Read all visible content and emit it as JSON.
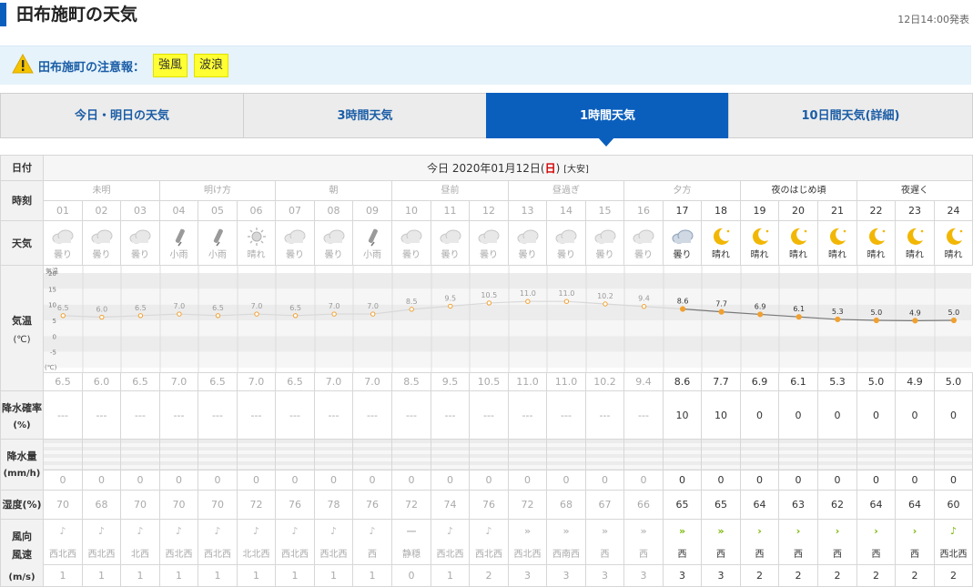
{
  "page": {
    "title": "田布施町の天気",
    "issued": "12日14:00発表"
  },
  "warning": {
    "label": "田布施町の注意報：",
    "items": [
      "強風",
      "波浪"
    ]
  },
  "tabs": [
    {
      "label": "今日・明日の天気",
      "active": false
    },
    {
      "label": "3時間天気",
      "active": false
    },
    {
      "label": "1時間天気",
      "active": true
    },
    {
      "label": "10日間天気(詳細)",
      "active": false
    }
  ],
  "table": {
    "labels": {
      "date": "日付",
      "time": "時刻",
      "weather": "天気",
      "temp": "気温",
      "temp_unit": "(℃)",
      "precip_prob": "降水確率",
      "precip_prob_unit": "(%)",
      "precip_amt": "降水量",
      "precip_amt_unit": "(mm/h)",
      "humidity": "湿度(%)",
      "wind_dir": "風向",
      "wind_speed": "風速",
      "wind_unit": "(m/s)"
    },
    "date": {
      "prefix": "今日 2020年01月12日(",
      "dow": "日",
      "suffix": ")",
      "rokuyo": "[大安]"
    },
    "periods": [
      "未明",
      "明け方",
      "朝",
      "昼前",
      "昼過ぎ",
      "夕方",
      "夜のはじめ頃",
      "夜遅く"
    ],
    "hours": [
      "01",
      "02",
      "03",
      "04",
      "05",
      "06",
      "07",
      "08",
      "09",
      "10",
      "11",
      "12",
      "13",
      "14",
      "15",
      "16",
      "17",
      "18",
      "19",
      "20",
      "21",
      "22",
      "23",
      "24"
    ],
    "weather": [
      "曇り",
      "曇り",
      "曇り",
      "小雨",
      "小雨",
      "晴れ",
      "曇り",
      "曇り",
      "小雨",
      "曇り",
      "曇り",
      "曇り",
      "曇り",
      "曇り",
      "曇り",
      "曇り",
      "曇り",
      "晴れ",
      "晴れ",
      "晴れ",
      "晴れ",
      "晴れ",
      "晴れ",
      "晴れ"
    ],
    "weather_icons": [
      "cloud-icon",
      "cloud-icon",
      "cloud-icon",
      "umbrella-icon",
      "umbrella-icon",
      "sun-icon",
      "cloud-icon",
      "cloud-icon",
      "umbrella-icon",
      "cloud-icon",
      "cloud-icon",
      "cloud-icon",
      "cloud-icon",
      "cloud-icon",
      "cloud-icon",
      "cloud-icon",
      "cloud-icon",
      "moon-icon",
      "moon-icon",
      "moon-icon",
      "moon-icon",
      "moon-icon",
      "moon-icon",
      "moon-icon"
    ],
    "temps_display": [
      "6.5",
      "6.0",
      "6.5",
      "7.0",
      "6.5",
      "7.0",
      "6.5",
      "7.0",
      "7.0",
      "8.5",
      "9.5",
      "10.5",
      "11.0",
      "11.0",
      "10.2",
      "9.4",
      "8.6",
      "7.7",
      "6.9",
      "6.1",
      "5.3",
      "5.0",
      "4.9",
      "5.0"
    ],
    "precip_prob": [
      "---",
      "---",
      "---",
      "---",
      "---",
      "---",
      "---",
      "---",
      "---",
      "---",
      "---",
      "---",
      "---",
      "---",
      "---",
      "---",
      "10",
      "10",
      "0",
      "0",
      "0",
      "0",
      "0",
      "0"
    ],
    "precip_amt": [
      "0",
      "0",
      "0",
      "0",
      "0",
      "0",
      "0",
      "0",
      "0",
      "0",
      "0",
      "0",
      "0",
      "0",
      "0",
      "0",
      "0",
      "0",
      "0",
      "0",
      "0",
      "0",
      "0",
      "0"
    ],
    "humidity": [
      "70",
      "68",
      "70",
      "70",
      "70",
      "72",
      "76",
      "78",
      "76",
      "72",
      "74",
      "76",
      "72",
      "68",
      "67",
      "66",
      "65",
      "65",
      "64",
      "63",
      "62",
      "64",
      "64",
      "60"
    ],
    "wind_dir": [
      "西北西",
      "西北西",
      "北西",
      "西北西",
      "西北西",
      "北北西",
      "西北西",
      "西北西",
      "西",
      "静穏",
      "西北西",
      "西北西",
      "西北西",
      "西南西",
      "西",
      "西",
      "西",
      "西",
      "西",
      "西",
      "西",
      "西",
      "西",
      "西北西"
    ],
    "wind_glyph": [
      "♪",
      "♪",
      "♪",
      "♪",
      "♪",
      "♪",
      "♪",
      "♪",
      "♪",
      "—",
      "♪",
      "♪",
      "»",
      "»",
      "»",
      "»",
      "»",
      "»",
      "›",
      "›",
      "›",
      "›",
      "›",
      "♪"
    ],
    "wind_speed": [
      "1",
      "1",
      "1",
      "1",
      "1",
      "1",
      "1",
      "1",
      "1",
      "0",
      "1",
      "2",
      "3",
      "3",
      "3",
      "3",
      "3",
      "3",
      "2",
      "2",
      "2",
      "2",
      "2",
      "2"
    ],
    "past_count": 16
  },
  "chart_data": {
    "type": "line",
    "x": [
      "01",
      "02",
      "03",
      "04",
      "05",
      "06",
      "07",
      "08",
      "09",
      "10",
      "11",
      "12",
      "13",
      "14",
      "15",
      "16",
      "17",
      "18",
      "19",
      "20",
      "21",
      "22",
      "23",
      "24"
    ],
    "values": [
      6.5,
      6.0,
      6.5,
      7.0,
      6.5,
      7.0,
      6.5,
      7.0,
      7.0,
      8.5,
      9.5,
      10.5,
      11.0,
      11.0,
      10.2,
      9.4,
      8.6,
      7.7,
      6.9,
      6.1,
      5.3,
      5.0,
      4.9,
      5.0
    ],
    "ylabel": "気温",
    "yunit": "(℃)",
    "yticks": [
      20,
      15,
      10,
      5,
      0,
      -5
    ],
    "ylim": [
      -10,
      20
    ],
    "colors": {
      "past": "#d8d8d8",
      "future": "#777777",
      "marker": "#f0a030",
      "band_a": "#ececec",
      "band_b": "#f6f6f6"
    }
  },
  "colors": {
    "accent": "#0a5fbd",
    "link": "#1b5da6",
    "badge": "#ffff33"
  }
}
